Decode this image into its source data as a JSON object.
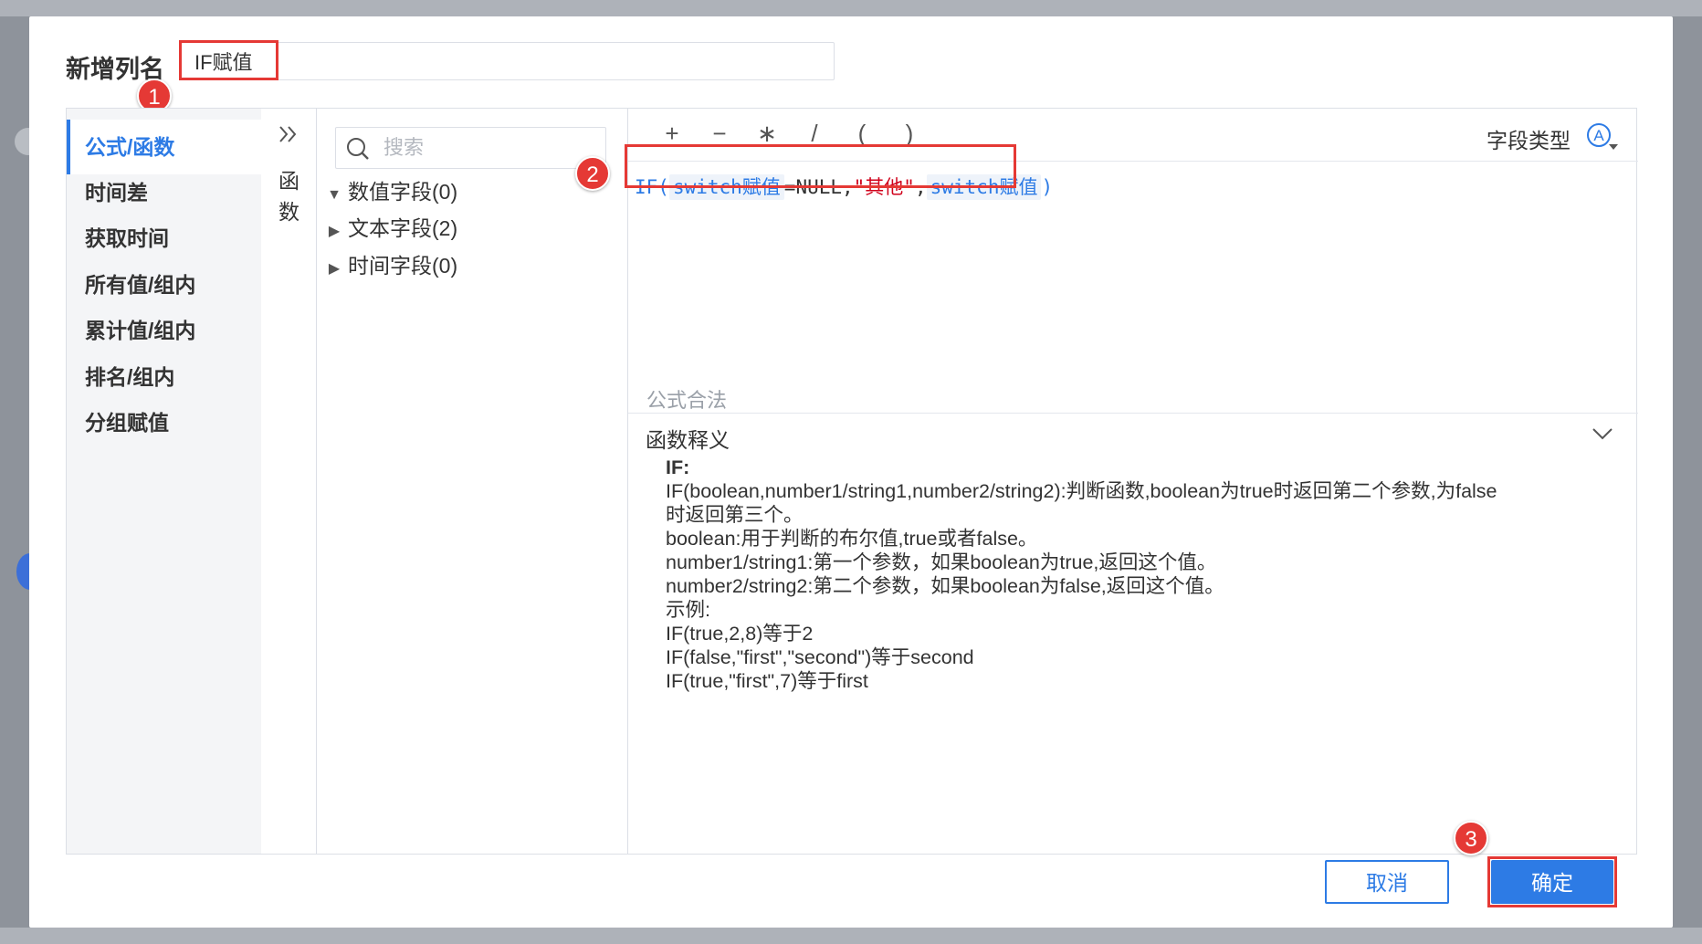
{
  "dialog": {
    "title": "新增列名",
    "column_name_value": "IF赋值"
  },
  "badges": [
    "1",
    "2",
    "3"
  ],
  "categories": [
    {
      "label": "公式/函数",
      "active": true
    },
    {
      "label": "时间差",
      "active": false
    },
    {
      "label": "获取时间",
      "active": false
    },
    {
      "label": "所有值/组内",
      "active": false
    },
    {
      "label": "累计值/组内",
      "active": false
    },
    {
      "label": "排名/组内",
      "active": false
    },
    {
      "label": "分组赋值",
      "active": false
    }
  ],
  "function_column": {
    "label_line1": "函",
    "label_line2": "数",
    "toggle_icon": "double-chevron-right-icon"
  },
  "fields": {
    "search_placeholder": "搜索",
    "groups": [
      "数值字段(0)",
      "文本字段(2)",
      "时间字段(0)"
    ],
    "group_states": [
      "expanded",
      "collapsed",
      "collapsed"
    ]
  },
  "operators": [
    "+",
    "−",
    "∗",
    "/",
    "(",
    ")"
  ],
  "field_type": {
    "label": "字段类型",
    "icon": "circled-a-icon"
  },
  "formula": {
    "func": "IF(",
    "field1": "switch赋值",
    "middle": "=NULL,",
    "string_literal": "\"其他\"",
    "comma": ",",
    "field2": "switch赋值",
    "close": ")"
  },
  "validation_text": "公式合法",
  "explanation": {
    "title": "函数释义",
    "func_name": "IF:",
    "lines": [
      "IF(boolean,number1/string1,number2/string2):判断函数,boolean为true时返回第二个参数,为false",
      "时返回第三个。",
      "boolean:用于判断的布尔值,true或者false。",
      "number1/string1:第一个参数，如果boolean为true,返回这个值。",
      "number2/string2:第二个参数，如果boolean为false,返回这个值。",
      "示例:",
      "IF(true,2,8)等于2",
      "IF(false,\"first\",\"second\")等于second",
      "IF(true,\"first\",7)等于first"
    ]
  },
  "buttons": {
    "cancel": "取消",
    "ok": "确定"
  },
  "colors": {
    "accent": "#2d7be5",
    "highlight": "#e53935",
    "string": "#d0021b",
    "overlay": "#8e939b"
  }
}
